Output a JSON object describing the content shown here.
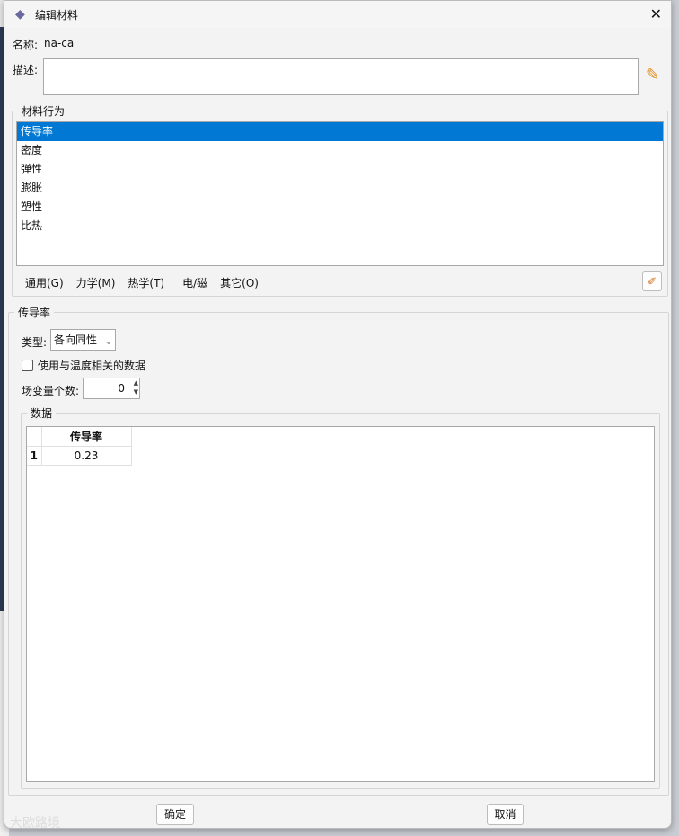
{
  "window": {
    "title": "编辑材料",
    "close": "✕"
  },
  "name": {
    "label": "名称:",
    "value": "na-ca"
  },
  "description": {
    "label": "描述:",
    "value": ""
  },
  "behaviors": {
    "legend": "材料行为",
    "items": [
      "传导率",
      "密度",
      "弹性",
      "膨胀",
      "塑性",
      "比热"
    ],
    "selected": 0
  },
  "menu": [
    "通用(G)",
    "力学(M)",
    "热学(T)",
    "_电/磁",
    "其它(O)"
  ],
  "section": {
    "title": "传导率",
    "type_label": "类型:",
    "type_value": "各向同性",
    "temp_checkbox": "使用与温度相关的数据",
    "temp_checked": false,
    "field_label": "场变量个数:",
    "field_value": "0"
  },
  "data": {
    "legend": "数据",
    "columns": [
      "传导率"
    ],
    "rows": [
      [
        "1",
        "0.23"
      ]
    ]
  },
  "buttons": {
    "ok": "确定",
    "cancel": "取消"
  },
  "watermark": "大欧路境"
}
